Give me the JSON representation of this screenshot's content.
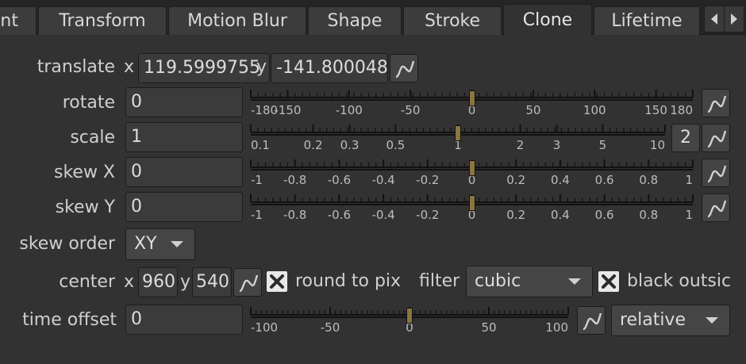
{
  "tabs": [
    {
      "label": "nt",
      "active": false
    },
    {
      "label": "Transform",
      "active": false
    },
    {
      "label": "Motion Blur",
      "active": false
    },
    {
      "label": "Shape",
      "active": false
    },
    {
      "label": "Stroke",
      "active": false
    },
    {
      "label": "Clone",
      "active": true
    },
    {
      "label": "Lifetime",
      "active": false
    }
  ],
  "translate": {
    "label": "translate",
    "x_label": "x",
    "x_value": "119.5999755",
    "y_label": "y",
    "y_value": "-141.800048"
  },
  "rotate": {
    "label": "rotate",
    "value": "0",
    "slider": {
      "min": -180,
      "max": 180,
      "value": 0,
      "ticks": [
        "-180",
        "-150",
        "-100",
        "-50",
        "0",
        "50",
        "100",
        "150",
        "180"
      ]
    }
  },
  "scale": {
    "label": "scale",
    "value": "1",
    "channels_button": "2",
    "slider": {
      "value": 1,
      "ticks": [
        "0.1",
        "0.2",
        "0.3",
        "0.5",
        "1",
        "2",
        "3",
        "5",
        "10"
      ]
    }
  },
  "skew_x": {
    "label": "skew X",
    "value": "0",
    "slider": {
      "min": -1,
      "max": 1,
      "value": 0,
      "ticks": [
        "-1",
        "-0.8",
        "-0.6",
        "-0.4",
        "-0.2",
        "0",
        "0.2",
        "0.4",
        "0.6",
        "0.8",
        "1"
      ]
    }
  },
  "skew_y": {
    "label": "skew Y",
    "value": "0",
    "slider": {
      "min": -1,
      "max": 1,
      "value": 0,
      "ticks": [
        "-1",
        "-0.8",
        "-0.6",
        "-0.4",
        "-0.2",
        "0",
        "0.2",
        "0.4",
        "0.6",
        "0.8",
        "1"
      ]
    }
  },
  "skew_order": {
    "label": "skew order",
    "value": "XY"
  },
  "center": {
    "label": "center",
    "x_label": "x",
    "x_value": "960",
    "y_label": "y",
    "y_value": "540"
  },
  "round_to_pixel": {
    "label": "round to pix",
    "checked": true
  },
  "filter": {
    "label": "filter",
    "value": "cubic"
  },
  "black_outside": {
    "label": "black outsic",
    "checked": true
  },
  "time_offset": {
    "label": "time offset",
    "value": "0",
    "mode": "relative",
    "slider": {
      "min": -100,
      "max": 100,
      "value": 0,
      "ticks": [
        "-100",
        "-50",
        "0",
        "50",
        "100"
      ]
    }
  },
  "colors": {
    "panel": "#323232",
    "field": "#3b3b3b",
    "handle": "#8a7440",
    "checkbox": "#e8e8e8"
  }
}
